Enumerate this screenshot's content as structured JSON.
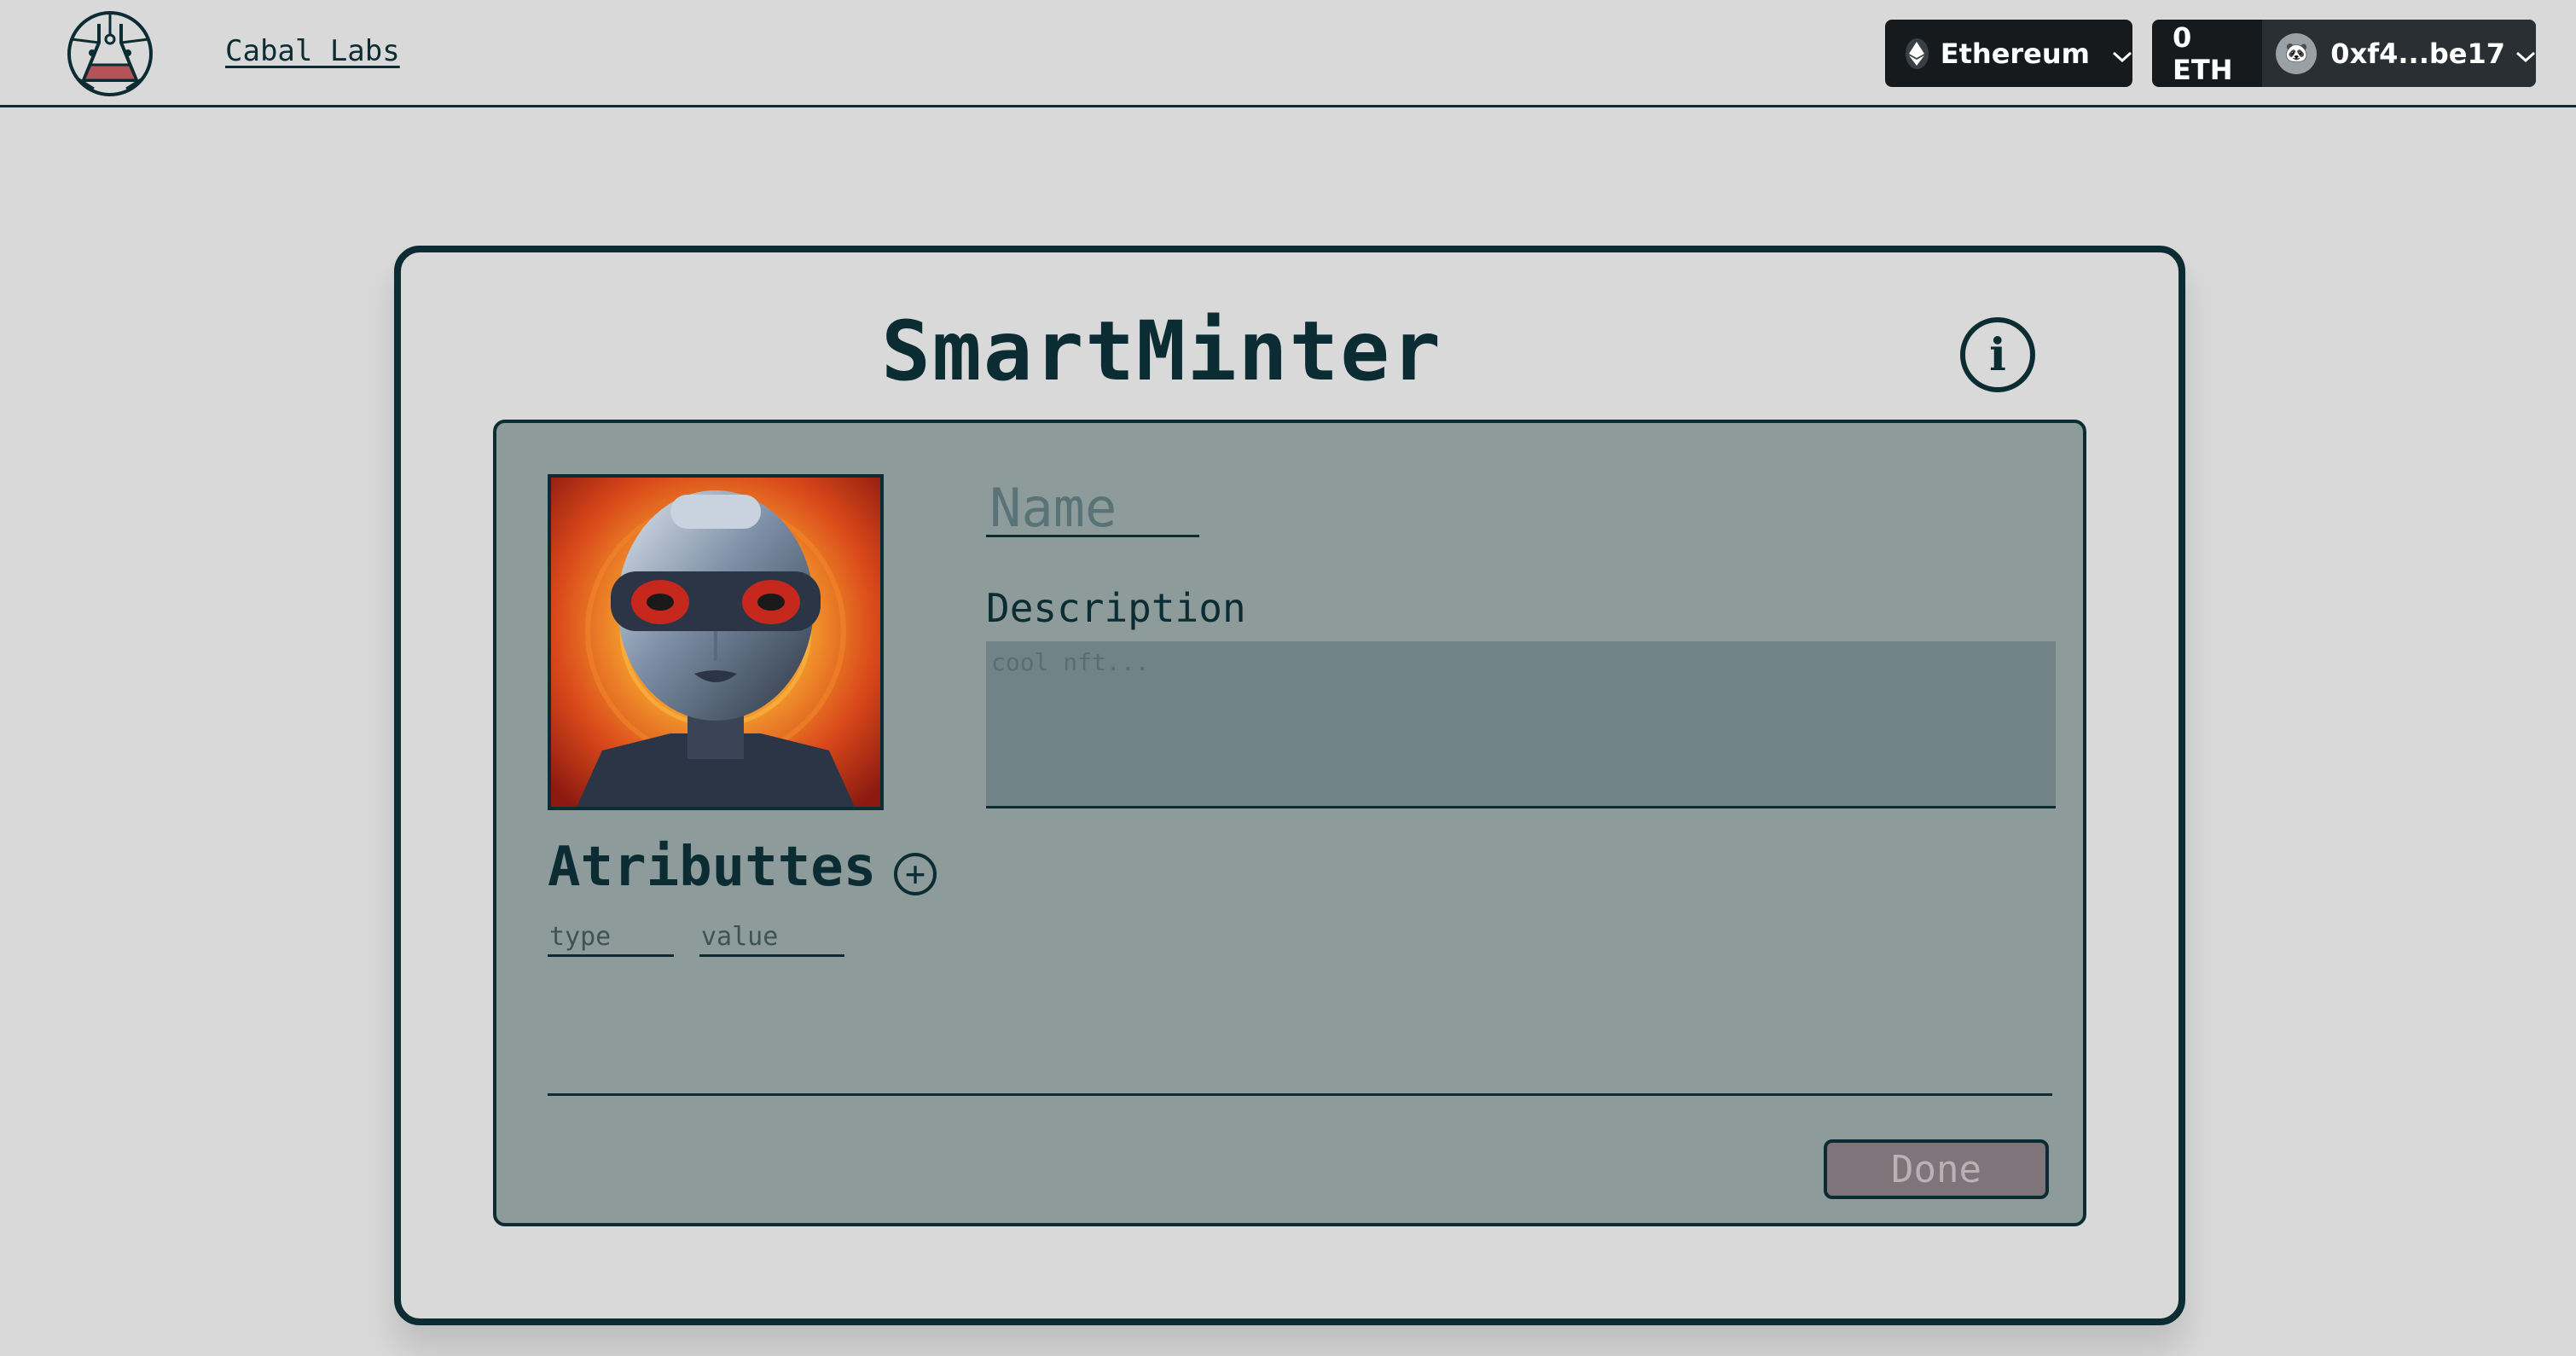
{
  "header": {
    "brand": "Cabal Labs",
    "logo_icon": "flask-circle-logo-icon",
    "network": {
      "label": "Ethereum",
      "icon": "ethereum-icon"
    },
    "account": {
      "balance": "0 ETH",
      "address": "0xf4...be17",
      "avatar_icon": "panda-avatar-icon"
    }
  },
  "card": {
    "title": "SmartMinter",
    "info_icon": "info-icon",
    "form": {
      "name_placeholder": "Name",
      "name_value": "",
      "description_label": "Description",
      "description_placeholder": "cool nft...",
      "description_value": "",
      "attributes_label": "Atributtes",
      "add_attribute_icon": "plus-circle-icon",
      "attribute_type_placeholder": "type",
      "attribute_value_placeholder": "value",
      "done_label": "Done"
    }
  },
  "colors": {
    "background": "#d9d9d9",
    "primary": "#0c2c33",
    "panel": "#8d9b9b",
    "textarea": "#728388",
    "done_button": "#7f7479",
    "wallet_bg": "#161a1d"
  }
}
